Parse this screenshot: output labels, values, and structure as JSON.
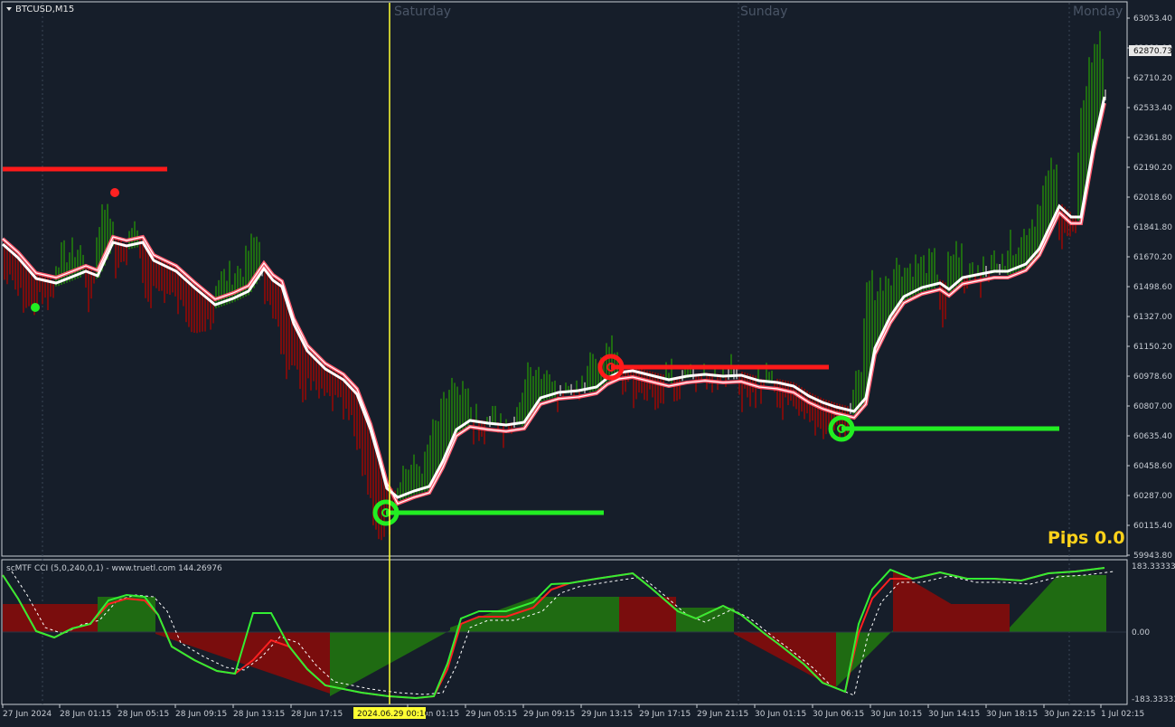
{
  "chart": {
    "symbol_label": "BTCUSD,M15",
    "day_labels": [
      {
        "text": "Saturday",
        "x_index": 0
      },
      {
        "text": "Sunday",
        "x_index": 1
      },
      {
        "text": "Monday",
        "x_index": 2
      }
    ],
    "price_axis": [
      "63053.40",
      "62880.00",
      "62710.20",
      "62533.40",
      "62361.80",
      "62190.20",
      "62018.60",
      "61841.80",
      "61670.20",
      "61498.60",
      "61327.00",
      "61150.20",
      "60978.60",
      "60807.00",
      "60635.40",
      "60458.60",
      "60287.00",
      "60115.40",
      "59943.80"
    ],
    "current_price": "62870.73",
    "pips_label": "Pips 0.0",
    "indicator_title": "scMTF CCI (5,0,240,0,1) - www.truetl.com 144.26976",
    "indicator_axis": [
      "183.33333",
      "0.00",
      "-183.33333"
    ],
    "time_axis": [
      "27 Jun 2024",
      "28 Jun 01:15",
      "28 Jun 05:15",
      "28 Jun 09:15",
      "28 Jun 13:15",
      "28 Jun 17:15",
      "29 Jun 01:15",
      "29 Jun 05:15",
      "29 Jun 09:15",
      "29 Jun 13:15",
      "29 Jun 17:15",
      "29 Jun 21:15",
      "30 Jun 01:15",
      "30 Jun 06:15",
      "30 Jun 10:15",
      "30 Jun 14:15",
      "30 Jun 18:15",
      "30 Jun 22:15",
      "1 Jul 02:15"
    ],
    "cursor_time": "2024.06.29 00:10",
    "colors": {
      "background": "#161e2a",
      "bull": "#1f6b12",
      "bear": "#7a0d0d",
      "neutral": "#8a8a8a",
      "ma_fast": "#ffffff",
      "ma_slow": "#ff5a6e",
      "level_red": "#ff1a1a",
      "level_green": "#22ee22",
      "cursor": "#ffff33",
      "pips": "#ffd21a"
    }
  }
}
